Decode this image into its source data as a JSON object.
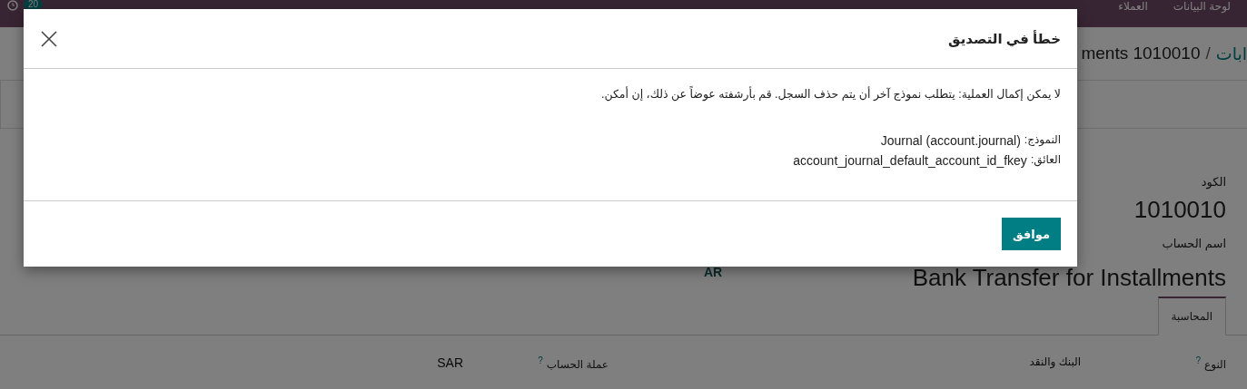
{
  "navbar": {
    "badge": "20",
    "menu": [
      "لوحة البيانات",
      "العملاء"
    ]
  },
  "breadcrumb": {
    "parent": "ابات",
    "separator": "/",
    "current": "ments 1010010"
  },
  "form": {
    "code_label": "الكود",
    "code": "1010010",
    "name_label": "اسم الحساب",
    "name": "Bank Transfer for Installments",
    "tag": "AR",
    "tabs": [
      {
        "label": "المحاسبة",
        "selected": true
      }
    ],
    "fields": [
      {
        "label": "النوع",
        "help": "?",
        "value": "البنك والنقد",
        "kind": "text"
      },
      {
        "label": "عملة الحساب",
        "help": "?",
        "value": "SAR",
        "kind": "select"
      }
    ]
  },
  "dialog": {
    "title": "خطأ في التصديق",
    "message": "لا يمكن إكمال العملية: يتطلب نموذج آخر أن يتم حذف السجل. قم بأرشفته عوضاً عن ذلك، إن أمكن.",
    "details": [
      {
        "label": "النموذج:",
        "value": "Journal (account.journal)"
      },
      {
        "label": "العائق:",
        "value": "account_journal_default_account_id_fkey"
      }
    ],
    "button": "موافق"
  }
}
